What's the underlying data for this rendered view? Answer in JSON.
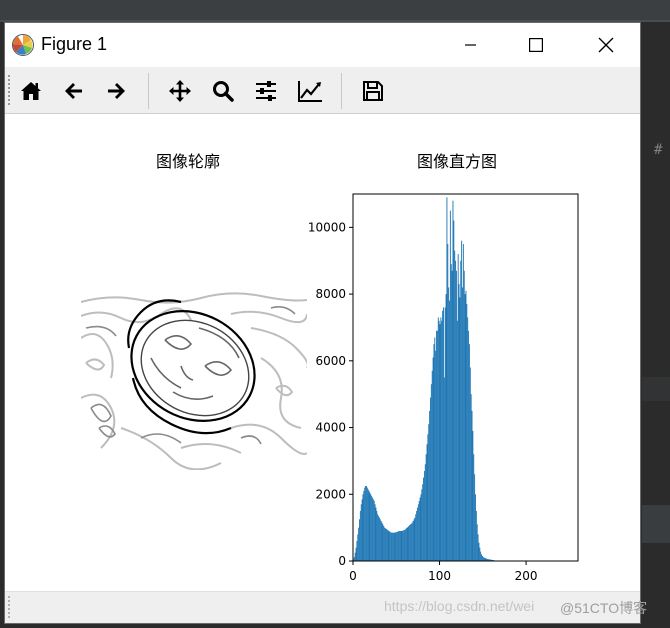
{
  "window": {
    "title": "Figure 1"
  },
  "toolbar": {
    "buttons": [
      {
        "icon": "home-icon",
        "tooltip": "Home"
      },
      {
        "icon": "back-icon",
        "tooltip": "Back"
      },
      {
        "icon": "forward-icon",
        "tooltip": "Forward"
      },
      {
        "icon": "pan-icon",
        "tooltip": "Pan"
      },
      {
        "icon": "zoom-icon",
        "tooltip": "Zoom"
      },
      {
        "icon": "configure-subplots-icon",
        "tooltip": "Subplots"
      },
      {
        "icon": "edit-axis-icon",
        "tooltip": "Customize"
      },
      {
        "icon": "save-icon",
        "tooltip": "Save"
      }
    ]
  },
  "subplots": {
    "left_title": "图像轮廓",
    "right_title": "图像直方图"
  },
  "chart_data": {
    "type": "bar",
    "title": "图像直方图",
    "xlabel": "",
    "ylabel": "",
    "xlim": [
      0,
      260
    ],
    "ylim": [
      0,
      11000
    ],
    "xticks": [
      0,
      100,
      200
    ],
    "yticks": [
      0,
      2000,
      4000,
      6000,
      8000,
      10000
    ],
    "bar_color": "#1f77b4",
    "bins": 256,
    "x": [
      0,
      1,
      2,
      3,
      4,
      5,
      6,
      7,
      8,
      9,
      10,
      11,
      12,
      13,
      14,
      15,
      16,
      17,
      18,
      19,
      20,
      21,
      22,
      23,
      24,
      25,
      26,
      27,
      28,
      29,
      30,
      31,
      32,
      33,
      34,
      35,
      36,
      37,
      38,
      39,
      40,
      41,
      42,
      43,
      44,
      45,
      46,
      47,
      48,
      49,
      50,
      51,
      52,
      53,
      54,
      55,
      56,
      57,
      58,
      59,
      60,
      61,
      62,
      63,
      64,
      65,
      66,
      67,
      68,
      69,
      70,
      71,
      72,
      73,
      74,
      75,
      76,
      77,
      78,
      79,
      80,
      81,
      82,
      83,
      84,
      85,
      86,
      87,
      88,
      89,
      90,
      91,
      92,
      93,
      94,
      95,
      96,
      97,
      98,
      99,
      100,
      101,
      102,
      103,
      104,
      105,
      106,
      107,
      108,
      109,
      110,
      111,
      112,
      113,
      114,
      115,
      116,
      117,
      118,
      119,
      120,
      121,
      122,
      123,
      124,
      125,
      126,
      127,
      128,
      129,
      130,
      131,
      132,
      133,
      134,
      135,
      136,
      137,
      138,
      139,
      140,
      141,
      142,
      143,
      144,
      145,
      146,
      147,
      148,
      149,
      150,
      151,
      152,
      153,
      154,
      155,
      156,
      157,
      158,
      159,
      160,
      161,
      162,
      163,
      164,
      165,
      166,
      167,
      168,
      169,
      170,
      171,
      172,
      173,
      174,
      175,
      176,
      177,
      178,
      179,
      180,
      181,
      182,
      183,
      184,
      185,
      186,
      187,
      188,
      189,
      190,
      191,
      192,
      193,
      194,
      195,
      196,
      197,
      198,
      199,
      200,
      201,
      202,
      203,
      204,
      205,
      206,
      207,
      208,
      209,
      210,
      211,
      212,
      213,
      214,
      215,
      216,
      217,
      218,
      219,
      220,
      221,
      222,
      223,
      224,
      225,
      226,
      227,
      228,
      229,
      230,
      231,
      232,
      233,
      234,
      235,
      236,
      237,
      238,
      239,
      240,
      241,
      242,
      243,
      244,
      245,
      246,
      247,
      248,
      249,
      250,
      251,
      252,
      253,
      254,
      255
    ],
    "values": [
      50,
      120,
      250,
      400,
      600,
      800,
      1000,
      1250,
      1500,
      1700,
      1850,
      2000,
      2100,
      2200,
      2250,
      2250,
      2200,
      2150,
      2100,
      2050,
      2000,
      1950,
      1900,
      1850,
      1800,
      1700,
      1600,
      1500,
      1400,
      1350,
      1300,
      1250,
      1200,
      1150,
      1100,
      1050,
      1000,
      980,
      960,
      940,
      920,
      900,
      880,
      860,
      850,
      850,
      850,
      850,
      850,
      860,
      870,
      880,
      890,
      900,
      900,
      900,
      900,
      910,
      920,
      930,
      950,
      980,
      1000,
      1020,
      1050,
      1080,
      1100,
      1120,
      1150,
      1200,
      1250,
      1300,
      1400,
      1500,
      1600,
      1700,
      1800,
      1900,
      2000,
      2150,
      2300,
      2500,
      2700,
      2900,
      3200,
      3500,
      3800,
      4100,
      4500,
      4900,
      5300,
      5700,
      6100,
      6500,
      6700,
      6300,
      6900,
      6900,
      7300,
      7200,
      7100,
      7300,
      7200,
      7500,
      7600,
      5500,
      7600,
      8000,
      10900,
      9500,
      8200,
      7800,
      10500,
      8900,
      8700,
      10800,
      10200,
      9300,
      9000,
      8700,
      7200,
      9200,
      8300,
      7900,
      9000,
      9600,
      8200,
      9500,
      8700,
      8000,
      8100,
      7700,
      7300,
      6900,
      6500,
      5800,
      5000,
      4500,
      3900,
      3200,
      2600,
      2000,
      1500,
      1100,
      800,
      550,
      400,
      280,
      200,
      150,
      120,
      100,
      90,
      80,
      70,
      60,
      55,
      50,
      45,
      40,
      35,
      30,
      25,
      20,
      15,
      10,
      8,
      6,
      5,
      4,
      3,
      2,
      2,
      1,
      0,
      0,
      0,
      0,
      0,
      0,
      0,
      0,
      0,
      0,
      0,
      0,
      0,
      0,
      0,
      0,
      0,
      0,
      0,
      0,
      0,
      0,
      0,
      0,
      0,
      0,
      0,
      0,
      0,
      0,
      0,
      0,
      0,
      0,
      0,
      0,
      0,
      0,
      0,
      0,
      0,
      0,
      0,
      0,
      0,
      0,
      0,
      0,
      0,
      0,
      0,
      0,
      0,
      0,
      0,
      0,
      0,
      0,
      0,
      0,
      0,
      0,
      0,
      0,
      0,
      0,
      0,
      0,
      0,
      0,
      0,
      0,
      0,
      0,
      0,
      0,
      0,
      0,
      0,
      0,
      0,
      0,
      0,
      0,
      0,
      0,
      0
    ]
  },
  "watermark": {
    "text": "https://blog.csdn.net/wei",
    "text2": "@51CTO博客"
  }
}
